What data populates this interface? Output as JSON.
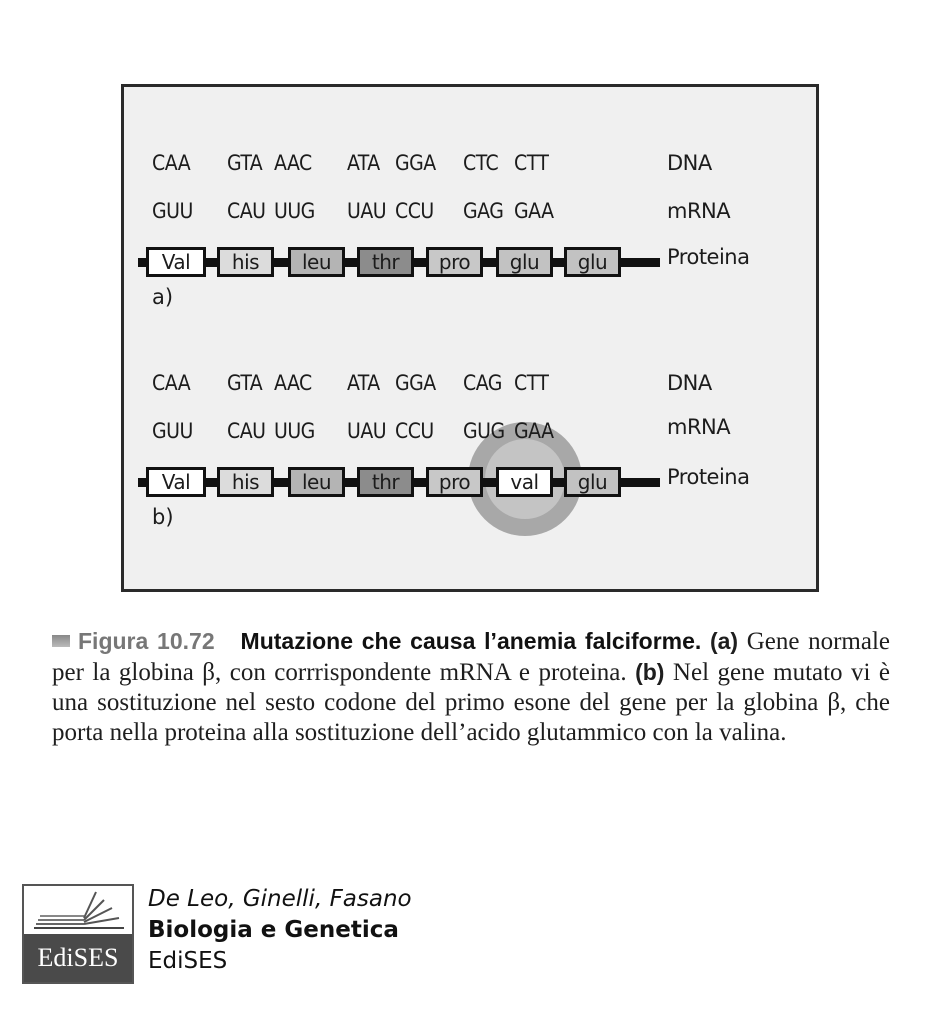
{
  "figure": {
    "panel_a": {
      "label": "a)",
      "dna": [
        "CAA",
        "GTA",
        "AAC",
        "ATA",
        "GGA",
        "CTC",
        "CTT"
      ],
      "mrna": [
        "GUU",
        "CAU",
        "UUG",
        "UAU",
        "CCU",
        "GAG",
        "GAA"
      ],
      "protein": [
        {
          "name": "Val",
          "fill": "#ffffff"
        },
        {
          "name": "his",
          "fill": "#dcdcdc"
        },
        {
          "name": "leu",
          "fill": "#b4b4b4"
        },
        {
          "name": "thr",
          "fill": "#8c8c8c"
        },
        {
          "name": "pro",
          "fill": "#c8c8c8"
        },
        {
          "name": "glu",
          "fill": "#c2c2c2"
        },
        {
          "name": "glu",
          "fill": "#c2c2c2"
        }
      ]
    },
    "panel_b": {
      "label": "b)",
      "dna": [
        "CAA",
        "GTA",
        "AAC",
        "ATA",
        "GGA",
        "CAG",
        "CTT"
      ],
      "mrna": [
        "GUU",
        "CAU",
        "UUG",
        "UAU",
        "CCU",
        "GUG",
        "GAA"
      ],
      "protein": [
        {
          "name": "Val",
          "fill": "#ffffff"
        },
        {
          "name": "his",
          "fill": "#dcdcdc"
        },
        {
          "name": "leu",
          "fill": "#b4b4b4"
        },
        {
          "name": "thr",
          "fill": "#8c8c8c"
        },
        {
          "name": "pro",
          "fill": "#c8c8c8"
        },
        {
          "name": "val",
          "fill": "#ffffff"
        },
        {
          "name": "glu",
          "fill": "#c2c2c2"
        }
      ],
      "highlighted_index": 5
    },
    "row_labels": {
      "dna": "DNA",
      "mrna": "mRNA",
      "protein": "Proteina"
    }
  },
  "caption": {
    "figure_number": "Figura 10.72",
    "title": "Mutazione che causa l’anemia falciforme.",
    "tag_a": "(a)",
    "text_a": " Gene normale per la globina β, con corrrispondente mRNA e proteina. ",
    "tag_b": "(b)",
    "text_b": " Nel gene mutato vi è una sostituzione nel sesto codone del primo esone del gene per la globina β, che porta nella proteina alla sostituzione dell’acido glutammico con la valina."
  },
  "publisher": {
    "logo_text": "EdiSES",
    "authors": "De Leo, Ginelli, Fasano",
    "book_title": "Biologia e Genetica",
    "publisher_name": "EdiSES"
  }
}
